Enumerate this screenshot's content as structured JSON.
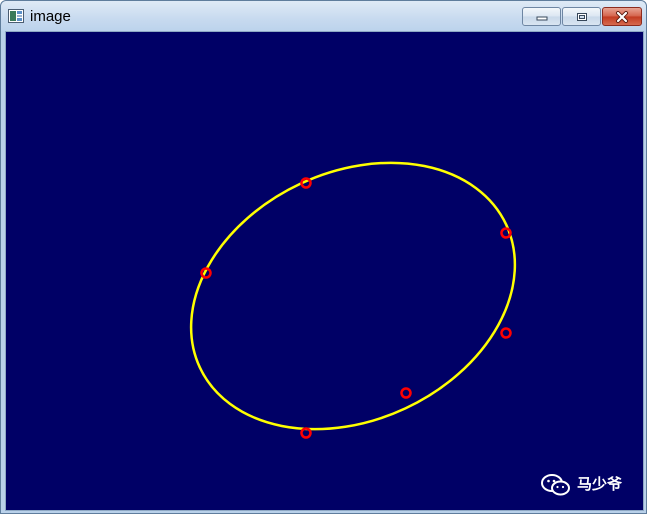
{
  "window": {
    "title": "image",
    "icon": "app-window-icon",
    "controls": {
      "minimize": "minimize-icon",
      "maximize": "maximize-icon",
      "close": "close-icon"
    }
  },
  "canvas": {
    "background_color": "#000066",
    "ellipse": {
      "stroke_color": "#ffff00"
    },
    "points": {
      "stroke_color": "#ff0000",
      "count": 6
    }
  },
  "watermark": {
    "icon": "wechat-icon",
    "text": "马少爷"
  }
}
